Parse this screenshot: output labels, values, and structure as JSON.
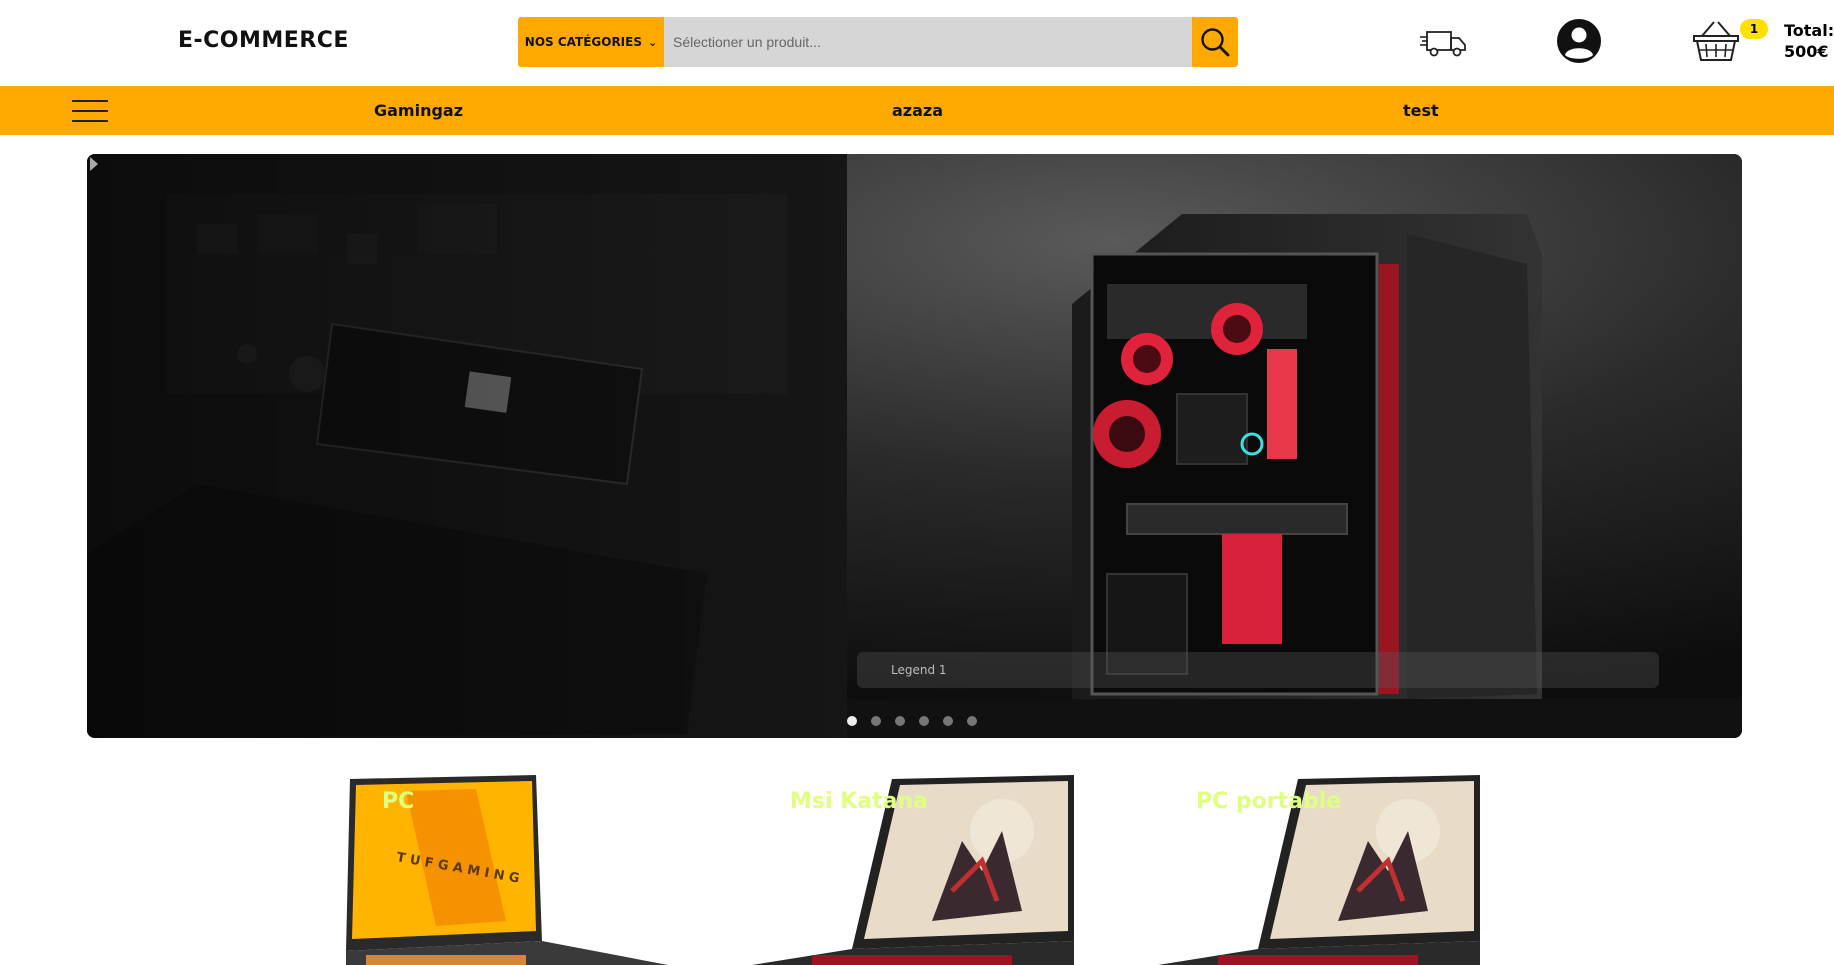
{
  "header": {
    "logo": "E-COMMERCE",
    "category_label": "NOS CATÉGORIES",
    "search_placeholder": "Sélectioner un produit...",
    "cart_count": "1",
    "total_label": "Total:",
    "total_value": "500€"
  },
  "nav": {
    "links": [
      "Gamingaz",
      "azaza",
      "test"
    ]
  },
  "carousel": {
    "caption": "Legend 1",
    "slide_count": 6,
    "active_index": 0
  },
  "products": [
    {
      "title": "PC"
    },
    {
      "title": "Msi Katana"
    },
    {
      "title": "PC portable"
    }
  ],
  "colors": {
    "accent": "#ffa800",
    "badge": "#ffe000",
    "product_title": "#dfff80"
  }
}
